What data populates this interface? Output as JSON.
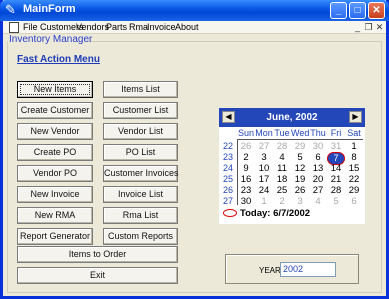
{
  "window": {
    "title": "MainForm"
  },
  "menu": {
    "items": [
      "File",
      "Customers",
      "Vendors",
      "Parts",
      "Rma",
      "Invoice",
      "About"
    ]
  },
  "group": {
    "legend": "Inventory Manager",
    "heading": "Fast Action Menu"
  },
  "buttons": {
    "left": [
      "New Items",
      "Create Customer",
      "New Vendor",
      "Create PO",
      "Vendor PO",
      "New Invoice",
      "New RMA",
      "Report Generator"
    ],
    "right": [
      "Items List",
      "Customer List",
      "Vendor List",
      "PO List",
      "Customer Invoices",
      "Invoice List",
      "Rma List",
      "Custom Reports"
    ],
    "items_to_order": "Items to Order",
    "exit": "Exit"
  },
  "calendar": {
    "title": "June, 2002",
    "days_of_week": [
      "Sun",
      "Mon",
      "Tue",
      "Wed",
      "Thu",
      "Fri",
      "Sat"
    ],
    "weeks": [
      {
        "wk": "22",
        "days": [
          "26",
          "27",
          "28",
          "29",
          "30",
          "31",
          "1"
        ]
      },
      {
        "wk": "23",
        "days": [
          "2",
          "3",
          "4",
          "5",
          "6",
          "7",
          "8"
        ]
      },
      {
        "wk": "24",
        "days": [
          "9",
          "10",
          "11",
          "12",
          "13",
          "14",
          "15"
        ]
      },
      {
        "wk": "25",
        "days": [
          "16",
          "17",
          "18",
          "19",
          "20",
          "21",
          "22"
        ]
      },
      {
        "wk": "26",
        "days": [
          "23",
          "24",
          "25",
          "26",
          "27",
          "28",
          "29"
        ]
      },
      {
        "wk": "27",
        "days": [
          "30",
          "1",
          "2",
          "3",
          "4",
          "5",
          "6"
        ]
      }
    ],
    "selected_day": "7",
    "today_text": "Today: 6/7/2002",
    "accent_color": "#2346b9"
  },
  "year": {
    "label": "YEAR:",
    "value": "2002"
  }
}
